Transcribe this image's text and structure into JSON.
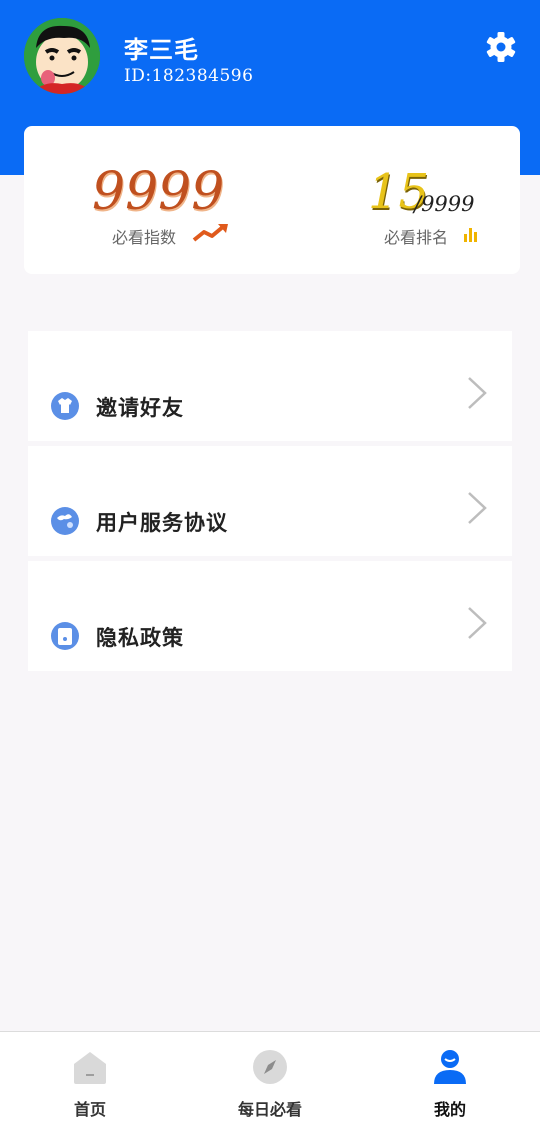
{
  "theme": {
    "header_blue": "#0a6bf5",
    "index_orange": "#c0501f",
    "rank_gold": "#e8c31a"
  },
  "profile": {
    "name": "李三毛",
    "id_text": "ID:182384596",
    "avatar_icon": "cartoon-avatar",
    "settings_icon": "gear-icon"
  },
  "stats": {
    "index_value": "9999",
    "index_label": "必看指数",
    "index_icon": "trend-up-icon",
    "rank_value": "15",
    "rank_total": "/9999",
    "rank_label": "必看排名",
    "rank_icon": "bar-chart-icon"
  },
  "menu": {
    "items": [
      {
        "label": "邀请好友",
        "icon": "invite-shirt-icon"
      },
      {
        "label": "用户服务协议",
        "icon": "globe-icon"
      },
      {
        "label": "隐私政策",
        "icon": "document-icon"
      }
    ],
    "chevron_icon": "chevron-right-icon"
  },
  "nav": {
    "items": [
      {
        "label": "首页",
        "icon": "home-icon",
        "active": false
      },
      {
        "label": "每日必看",
        "icon": "compass-icon",
        "active": false
      },
      {
        "label": "我的",
        "icon": "user-icon",
        "active": true
      }
    ]
  }
}
